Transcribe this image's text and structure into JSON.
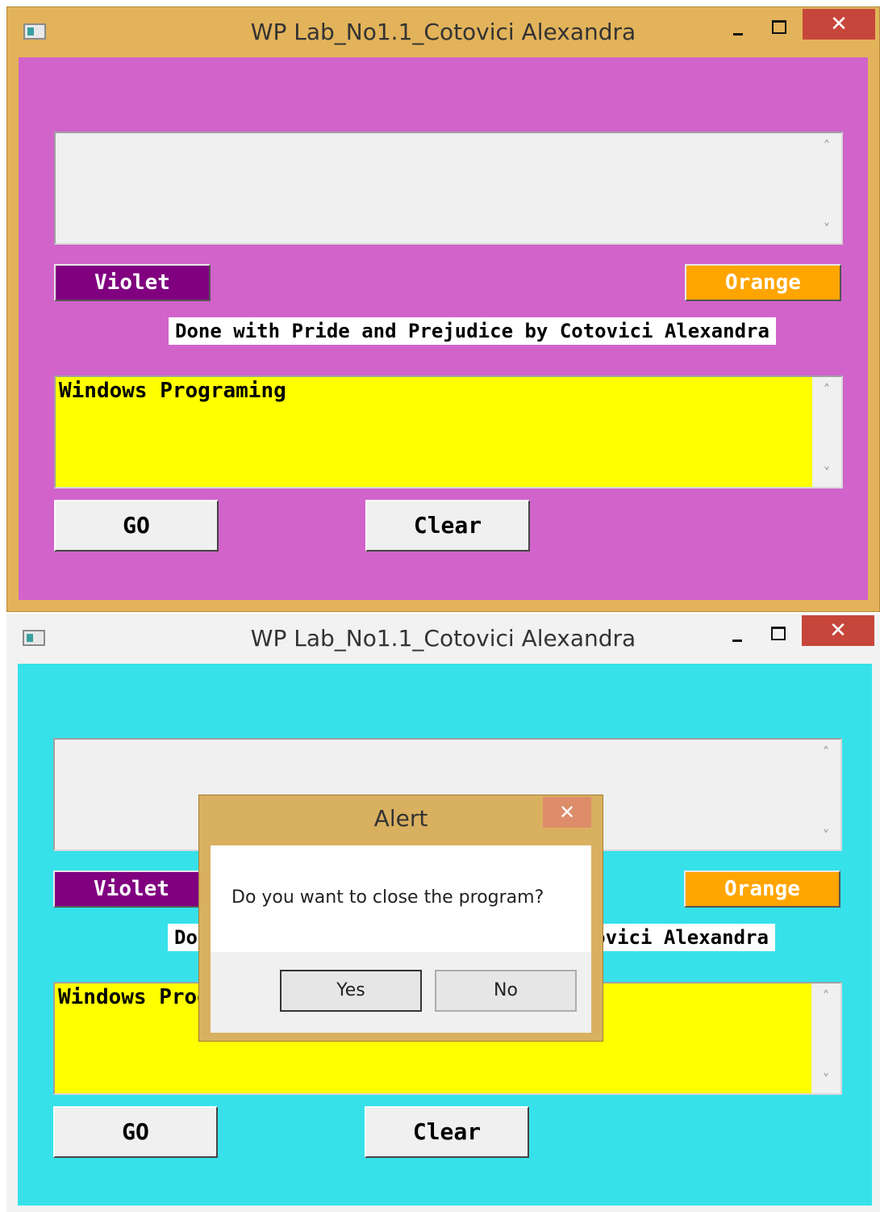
{
  "windows": [
    {
      "title": "WP Lab_No1.1_Cotovici Alexandra",
      "client_background": "#d163cb",
      "close_glyph": "✕",
      "top_edit": {
        "text": "",
        "scroll_up": "˄",
        "scroll_down": "˅"
      },
      "violet_label": "Violet",
      "orange_label": "Orange",
      "caption": "Done with Pride and Prejudice by Cotovici Alexandra",
      "bottom_edit": {
        "text": "Windows Programing",
        "scroll_up": "˄",
        "scroll_down": "˅"
      },
      "go_label": "GO",
      "clear_label": "Clear"
    },
    {
      "title": "WP Lab_No1.1_Cotovici Alexandra",
      "client_background": "#36e1ea",
      "close_glyph": "✕",
      "top_edit": {
        "text": "",
        "scroll_up": "˄",
        "scroll_down": "˅"
      },
      "violet_label": "Violet",
      "orange_label": "Orange",
      "caption": "Done with Pride and Prejudice by Cotovici Alexandra",
      "bottom_edit": {
        "text": "Windows Programing",
        "scroll_up": "˄",
        "scroll_down": "˅"
      },
      "go_label": "GO",
      "clear_label": "Clear"
    }
  ],
  "alert": {
    "title": "Alert",
    "close_glyph": "✕",
    "message": "Do you want to close the program?",
    "yes_label": "Yes",
    "no_label": "No"
  },
  "colors": {
    "violet": "#800080",
    "orange": "#ffa500",
    "edit_yellow": "#ffff00",
    "titlebar_gold": "#e2b35a",
    "close_red": "#c7463b"
  }
}
